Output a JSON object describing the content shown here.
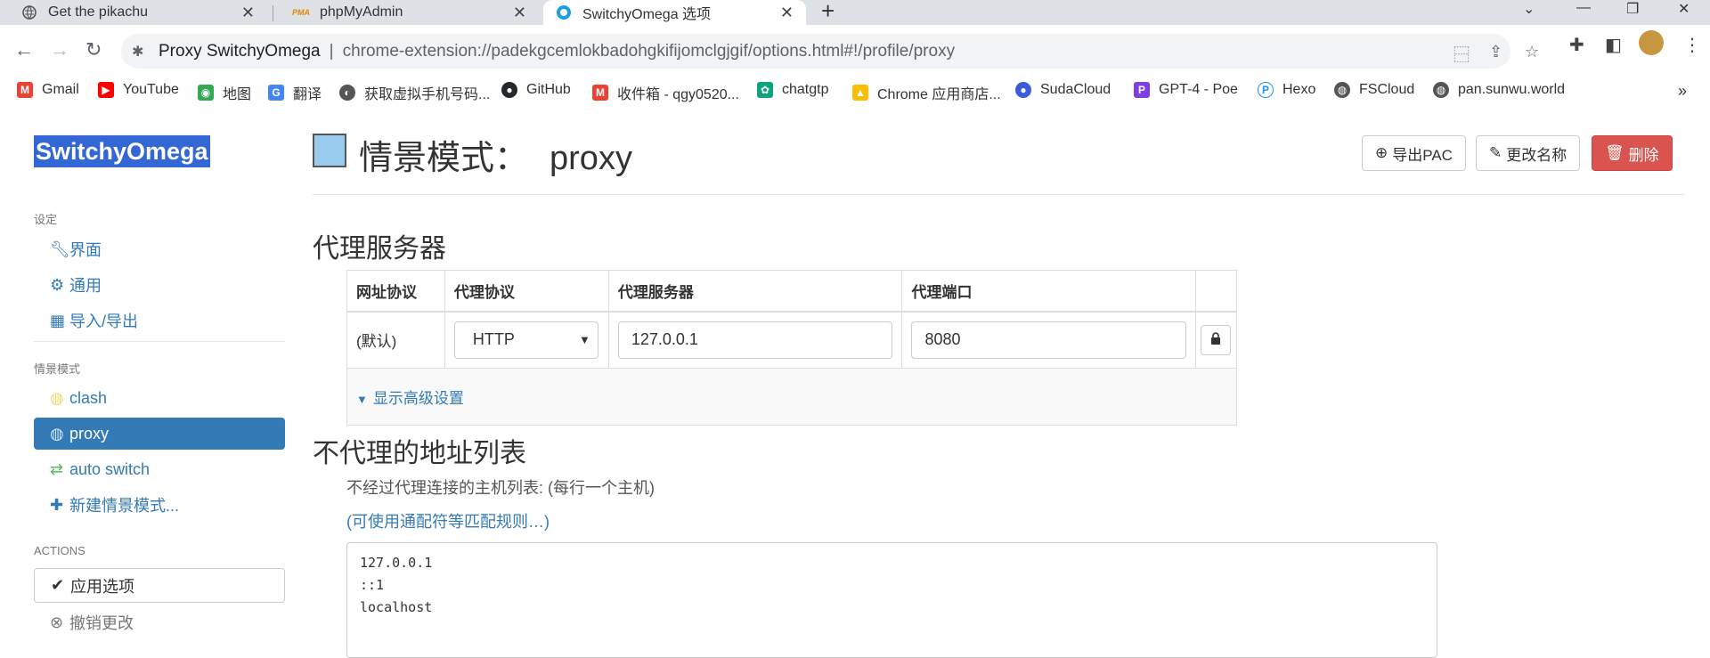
{
  "browser": {
    "tabs": [
      {
        "title": "Get the pikachu",
        "icon": "globe-icon"
      },
      {
        "title": "phpMyAdmin",
        "icon": "pma-icon"
      },
      {
        "title": "SwitchyOmega 选项",
        "icon": "switchyomega-icon"
      }
    ],
    "omnibox": {
      "site": "Proxy SwitchyOmega",
      "separator": "|",
      "url": "chrome-extension://padekgcemlokbadohgkifijomclgjgif/options.html#!/profile/proxy"
    },
    "bookmarks": [
      {
        "label": "Gmail",
        "icon": "gmail-icon",
        "color": "#ea4335"
      },
      {
        "label": "YouTube",
        "icon": "youtube-icon",
        "color": "#ff0000"
      },
      {
        "label": "地图",
        "icon": "maps-icon",
        "color": "#34a853"
      },
      {
        "label": "翻译",
        "icon": "translate-icon",
        "color": "#4285f4"
      },
      {
        "label": "获取虚拟手机号码...",
        "icon": "phone-icon",
        "color": "#555555"
      },
      {
        "label": "GitHub",
        "icon": "github-icon",
        "color": "#24292e"
      },
      {
        "label": "收件箱 - qgy0520...",
        "icon": "gmail-icon",
        "color": "#ea4335"
      },
      {
        "label": "chatgtp",
        "icon": "openai-icon",
        "color": "#10a37f"
      },
      {
        "label": "Chrome 应用商店...",
        "icon": "webstore-icon",
        "color": "#fbbc04"
      },
      {
        "label": "SudaCloud",
        "icon": "cloud-icon",
        "color": "#3b5bdb"
      },
      {
        "label": "GPT-4 - Poe",
        "icon": "poe-icon",
        "color": "#7b3fe4"
      },
      {
        "label": "Hexo",
        "icon": "hexo-icon",
        "color": "#1e90ff"
      },
      {
        "label": "FSCloud",
        "icon": "globe-icon",
        "color": "#555555"
      },
      {
        "label": "pan.sunwu.world",
        "icon": "globe-icon",
        "color": "#555555"
      }
    ],
    "more_bookmarks": "»"
  },
  "sidebar": {
    "brand": "SwitchyOmega",
    "settings_header": "设定",
    "settings_items": [
      {
        "label": "界面",
        "icon": "wrench-icon"
      },
      {
        "label": "通用",
        "icon": "gear-icon"
      },
      {
        "label": "导入/导出",
        "icon": "floppy-icon"
      }
    ],
    "profiles_header": "情景模式",
    "profile_items": [
      {
        "label": "clash",
        "icon": "globe-icon",
        "color": "#f5d76e"
      },
      {
        "label": "proxy",
        "icon": "globe-icon",
        "color": "#99ccee"
      },
      {
        "label": "auto switch",
        "icon": "switch-icon",
        "color": "#5cb85c"
      },
      {
        "label": "新建情景模式...",
        "icon": "plus-icon"
      }
    ],
    "actions_header": "ACTIONS",
    "apply_label": "应用选项",
    "discard_label": "撤销更改"
  },
  "profile": {
    "title_prefix": "情景模式：",
    "name": "proxy",
    "color": "#99ccee",
    "export_pac": "导出PAC",
    "rename": "更改名称",
    "delete": "删除"
  },
  "proxy_servers": {
    "heading": "代理服务器",
    "columns": [
      "网址协议",
      "代理协议",
      "代理服务器",
      "代理端口"
    ],
    "row": {
      "scheme": "(默认)",
      "protocol": "HTTP",
      "server": "127.0.0.1",
      "port": "8080"
    },
    "advanced_link": "显示高级设置"
  },
  "bypass": {
    "heading": "不代理的地址列表",
    "help": "不经过代理连接的主机列表: (每行一个主机)",
    "wildcard_link": "(可使用通配符等匹配规则…)",
    "list": "127.0.0.1\n::1\nlocalhost"
  }
}
